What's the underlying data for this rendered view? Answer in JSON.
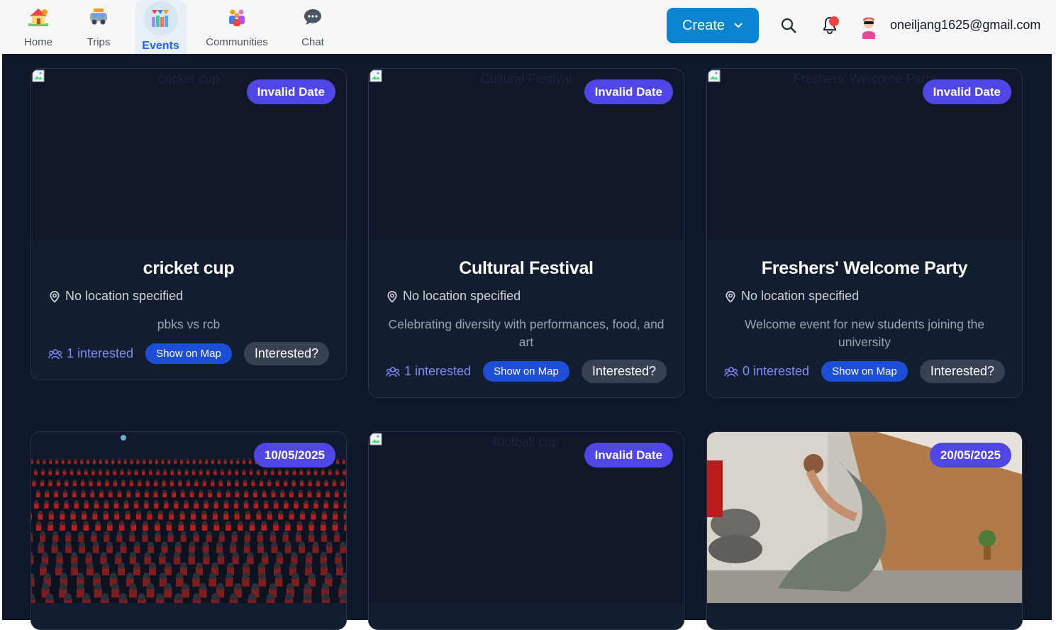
{
  "nav": {
    "items": [
      {
        "label": "Home",
        "icon": "home-icon"
      },
      {
        "label": "Trips",
        "icon": "car-icon"
      },
      {
        "label": "Events",
        "icon": "events-icon",
        "active": true
      },
      {
        "label": "Communities",
        "icon": "communities-icon"
      },
      {
        "label": "Chat",
        "icon": "chat-icon"
      }
    ]
  },
  "header": {
    "create_label": "Create",
    "email": "oneiljang1625@gmail.com",
    "accent": "#0a84d0"
  },
  "colors": {
    "badge": "#4f46e5",
    "map_button": "#1d4ed8",
    "interested_button": "#374151",
    "interested_text": "#818cf8"
  },
  "events": [
    {
      "title": "cricket cup",
      "badge": "Invalid Date",
      "alt": "cricket cup",
      "location": "No location specified",
      "description": "pbks vs rcb",
      "interested": "1 interested",
      "map_label": "Show on Map",
      "interest_label": "Interested?"
    },
    {
      "title": "Cultural Festival",
      "badge": "Invalid Date",
      "alt": "Cultural Festival",
      "location": "No location specified",
      "description": "Celebrating diversity with performances, food, and art",
      "interested": "1 interested",
      "map_label": "Show on Map",
      "interest_label": "Interested?"
    },
    {
      "title": "Freshers' Welcome Party",
      "badge": "Invalid Date",
      "alt": "Freshers' Welcome Party",
      "location": "No location specified",
      "description": "Welcome event for new students joining the university",
      "interested": "0 interested",
      "map_label": "Show on Map",
      "interest_label": "Interested?"
    },
    {
      "badge": "10/05/2025",
      "image": "cinema-audience-photo"
    },
    {
      "badge": "Invalid Date",
      "alt": "football cup"
    },
    {
      "badge": "20/05/2025",
      "image": "yoga-woman-photo"
    }
  ]
}
